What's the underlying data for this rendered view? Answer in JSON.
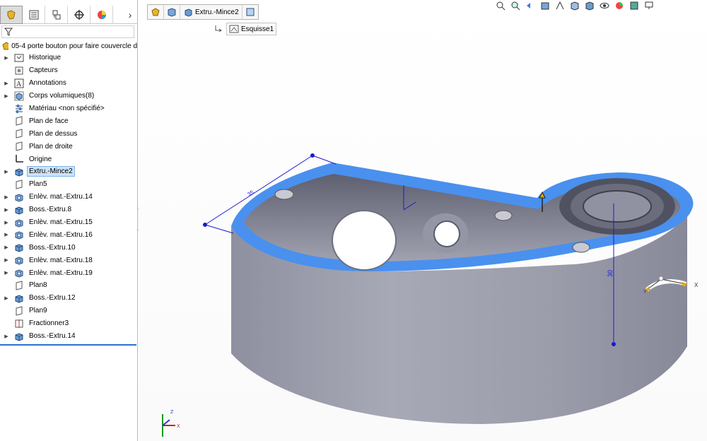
{
  "tabs": [
    {
      "name": "feature-manager"
    },
    {
      "name": "property-manager"
    },
    {
      "name": "configuration-manager"
    },
    {
      "name": "dimxpert-manager"
    },
    {
      "name": "display-manager"
    }
  ],
  "root": {
    "label": "05-4 porte bouton pour faire couvercle d"
  },
  "tree": [
    {
      "label": "Historique",
      "icon": "history-icon",
      "expandable": true
    },
    {
      "label": "Capteurs",
      "icon": "sensor-icon",
      "expandable": false
    },
    {
      "label": "Annotations",
      "icon": "annotation-icon",
      "expandable": true
    },
    {
      "label": "Corps volumiques(8)",
      "icon": "solid-bodies-icon",
      "expandable": true
    },
    {
      "label": "Matériau <non spécifié>",
      "icon": "material-icon",
      "expandable": false
    },
    {
      "label": "Plan de face",
      "icon": "plane-icon",
      "expandable": false
    },
    {
      "label": "Plan de dessus",
      "icon": "plane-icon",
      "expandable": false
    },
    {
      "label": "Plan de droite",
      "icon": "plane-icon",
      "expandable": false
    },
    {
      "label": "Origine",
      "icon": "origin-icon",
      "expandable": false
    },
    {
      "label": "Extru.-Mince2",
      "icon": "extrude-icon",
      "expandable": true,
      "selected": true
    },
    {
      "label": "Plan5",
      "icon": "plane-icon",
      "expandable": false
    },
    {
      "label": "Enlèv. mat.-Extru.14",
      "icon": "cut-extrude-icon",
      "expandable": true
    },
    {
      "label": "Boss.-Extru.8",
      "icon": "extrude-icon",
      "expandable": true
    },
    {
      "label": "Enlèv. mat.-Extru.15",
      "icon": "cut-extrude-icon",
      "expandable": true
    },
    {
      "label": "Enlèv. mat.-Extru.16",
      "icon": "cut-extrude-icon",
      "expandable": true
    },
    {
      "label": "Boss.-Extru.10",
      "icon": "extrude-icon",
      "expandable": true
    },
    {
      "label": "Enlèv. mat.-Extru.18",
      "icon": "cut-extrude-icon",
      "expandable": true
    },
    {
      "label": "Enlèv. mat.-Extru.19",
      "icon": "cut-extrude-icon",
      "expandable": true
    },
    {
      "label": "Plan8",
      "icon": "plane-icon",
      "expandable": false
    },
    {
      "label": "Boss.-Extru.12",
      "icon": "extrude-icon",
      "expandable": true
    },
    {
      "label": "Plan9",
      "icon": "plane-icon",
      "expandable": false
    },
    {
      "label": "Fractionner3",
      "icon": "split-icon",
      "expandable": false
    },
    {
      "label": "Boss.-Extru.14",
      "icon": "extrude-icon",
      "expandable": true
    }
  ],
  "breadcrumb": {
    "feature": "Extru.-Mince2",
    "sketch": "Esquisse1"
  },
  "viewport": {
    "dimension_vertical": "30",
    "dimension_angled": "35",
    "triad_axes": {
      "x": "X",
      "y": "Y",
      "z": "Z"
    },
    "colors": {
      "body": "#9a9ca9",
      "selection": "#4a90ee",
      "sketch": "#1a1ad0"
    }
  }
}
